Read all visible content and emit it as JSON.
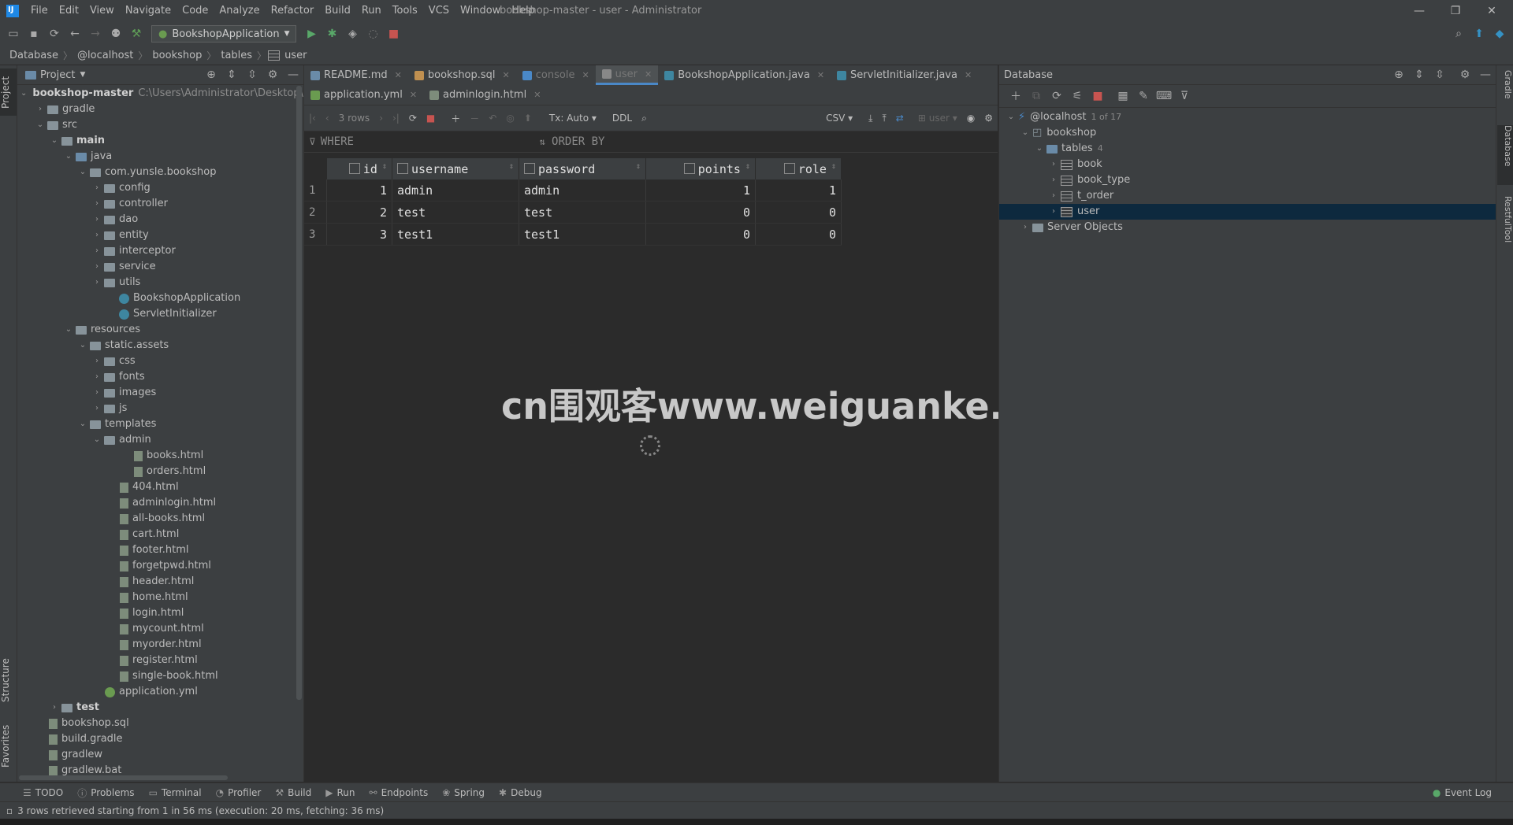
{
  "window": {
    "title": "bookshop-master - user - Administrator",
    "menu": [
      "File",
      "Edit",
      "View",
      "Navigate",
      "Code",
      "Analyze",
      "Refactor",
      "Build",
      "Run",
      "Tools",
      "VCS",
      "Window",
      "Help"
    ],
    "controls": [
      "—",
      "❐",
      "✕"
    ]
  },
  "toolbar": {
    "run_config": "BookshopApplication"
  },
  "breadcrumb": [
    "Database",
    "@localhost",
    "bookshop",
    "tables",
    "user"
  ],
  "project": {
    "title": "Project",
    "root_name": "bookshop-master",
    "root_path": "C:\\Users\\Administrator\\Desktop\\bo",
    "tree": [
      {
        "label": "gradle",
        "indent": 1,
        "chev": "›",
        "icon": "folder"
      },
      {
        "label": "src",
        "indent": 1,
        "chev": "⌄",
        "icon": "folder"
      },
      {
        "label": "main",
        "indent": 2,
        "chev": "⌄",
        "icon": "folder",
        "bold": true
      },
      {
        "label": "java",
        "indent": 3,
        "chev": "⌄",
        "icon": "src"
      },
      {
        "label": "com.yunsle.bookshop",
        "indent": 4,
        "chev": "⌄",
        "icon": "folder"
      },
      {
        "label": "config",
        "indent": 5,
        "chev": "›",
        "icon": "folder"
      },
      {
        "label": "controller",
        "indent": 5,
        "chev": "›",
        "icon": "folder"
      },
      {
        "label": "dao",
        "indent": 5,
        "chev": "›",
        "icon": "folder"
      },
      {
        "label": "entity",
        "indent": 5,
        "chev": "›",
        "icon": "folder"
      },
      {
        "label": "interceptor",
        "indent": 5,
        "chev": "›",
        "icon": "folder"
      },
      {
        "label": "service",
        "indent": 5,
        "chev": "›",
        "icon": "folder"
      },
      {
        "label": "utils",
        "indent": 5,
        "chev": "›",
        "icon": "folder"
      },
      {
        "label": "BookshopApplication",
        "indent": 6,
        "chev": "",
        "icon": "class"
      },
      {
        "label": "ServletInitializer",
        "indent": 6,
        "chev": "",
        "icon": "class"
      },
      {
        "label": "resources",
        "indent": 3,
        "chev": "⌄",
        "icon": "folder"
      },
      {
        "label": "static.assets",
        "indent": 4,
        "chev": "⌄",
        "icon": "folder"
      },
      {
        "label": "css",
        "indent": 5,
        "chev": "›",
        "icon": "folder"
      },
      {
        "label": "fonts",
        "indent": 5,
        "chev": "›",
        "icon": "folder"
      },
      {
        "label": "images",
        "indent": 5,
        "chev": "›",
        "icon": "folder"
      },
      {
        "label": "js",
        "indent": 5,
        "chev": "›",
        "icon": "folder"
      },
      {
        "label": "templates",
        "indent": 4,
        "chev": "⌄",
        "icon": "folder"
      },
      {
        "label": "admin",
        "indent": 5,
        "chev": "⌄",
        "icon": "folder"
      },
      {
        "label": "books.html",
        "indent": 7,
        "chev": "",
        "icon": "file"
      },
      {
        "label": "orders.html",
        "indent": 7,
        "chev": "",
        "icon": "file"
      },
      {
        "label": "404.html",
        "indent": 6,
        "chev": "",
        "icon": "file"
      },
      {
        "label": "adminlogin.html",
        "indent": 6,
        "chev": "",
        "icon": "file"
      },
      {
        "label": "all-books.html",
        "indent": 6,
        "chev": "",
        "icon": "file"
      },
      {
        "label": "cart.html",
        "indent": 6,
        "chev": "",
        "icon": "file"
      },
      {
        "label": "footer.html",
        "indent": 6,
        "chev": "",
        "icon": "file"
      },
      {
        "label": "forgetpwd.html",
        "indent": 6,
        "chev": "",
        "icon": "file"
      },
      {
        "label": "header.html",
        "indent": 6,
        "chev": "",
        "icon": "file"
      },
      {
        "label": "home.html",
        "indent": 6,
        "chev": "",
        "icon": "file"
      },
      {
        "label": "login.html",
        "indent": 6,
        "chev": "",
        "icon": "file"
      },
      {
        "label": "mycount.html",
        "indent": 6,
        "chev": "",
        "icon": "file"
      },
      {
        "label": "myorder.html",
        "indent": 6,
        "chev": "",
        "icon": "file"
      },
      {
        "label": "register.html",
        "indent": 6,
        "chev": "",
        "icon": "file"
      },
      {
        "label": "single-book.html",
        "indent": 6,
        "chev": "",
        "icon": "file"
      },
      {
        "label": "application.yml",
        "indent": 5,
        "chev": "",
        "icon": "yml"
      },
      {
        "label": "test",
        "indent": 2,
        "chev": "›",
        "icon": "folder",
        "bold": true
      },
      {
        "label": "bookshop.sql",
        "indent": 1,
        "chev": "",
        "icon": "file"
      },
      {
        "label": "build.gradle",
        "indent": 1,
        "chev": "",
        "icon": "file"
      },
      {
        "label": "gradlew",
        "indent": 1,
        "chev": "",
        "icon": "file"
      },
      {
        "label": "gradlew.bat",
        "indent": 1,
        "chev": "",
        "icon": "file"
      }
    ]
  },
  "editor_tabs_row1": [
    {
      "label": "README.md",
      "color": "#6a8ba8"
    },
    {
      "label": "bookshop.sql",
      "color": "#c09050"
    },
    {
      "label": "console",
      "color": "#4a88c7",
      "dim": true
    },
    {
      "label": "user",
      "color": "#888",
      "active": true
    },
    {
      "label": "BookshopApplication.java",
      "color": "#3e86a0"
    },
    {
      "label": "ServletInitializer.java",
      "color": "#3e86a0"
    }
  ],
  "editor_tabs_row2": [
    {
      "label": "application.yml",
      "color": "#6a9b50"
    },
    {
      "label": "adminlogin.html",
      "color": "#7d8c7b"
    }
  ],
  "grid_toolbar": {
    "rows": "3 rows",
    "tx": "Tx: Auto",
    "ddl": "DDL",
    "export": "CSV",
    "schema": "user"
  },
  "filter": {
    "where": "WHERE",
    "order_by": "ORDER BY"
  },
  "table": {
    "columns": [
      "id",
      "username",
      "password",
      "points",
      "role"
    ],
    "rows": [
      [
        "1",
        "1",
        "admin",
        "admin",
        "1",
        "1"
      ],
      [
        "2",
        "2",
        "test",
        "test",
        "0",
        "0"
      ],
      [
        "3",
        "3",
        "test1",
        "test1",
        "0",
        "0"
      ]
    ]
  },
  "watermark": "cn围观客www.weiguanke.cn",
  "database": {
    "title": "Database",
    "host": "@localhost",
    "host_count": "1 of 17",
    "schema": "bookshop",
    "tables_label": "tables",
    "tables_count": "4",
    "tables": [
      "book",
      "book_type",
      "t_order",
      "user"
    ],
    "server_objects": "Server Objects"
  },
  "left_stripe": [
    "Project",
    "Structure",
    "Favorites"
  ],
  "right_stripe": [
    "Gradle",
    "Database",
    "RestfulTool"
  ],
  "bottom_tools": [
    "TODO",
    "Problems",
    "Terminal",
    "Profiler",
    "Build",
    "Run",
    "Endpoints",
    "Spring",
    "Debug"
  ],
  "event_log": "Event Log",
  "status_text": "3 rows retrieved starting from 1 in 56 ms (execution: 20 ms, fetching: 36 ms)"
}
